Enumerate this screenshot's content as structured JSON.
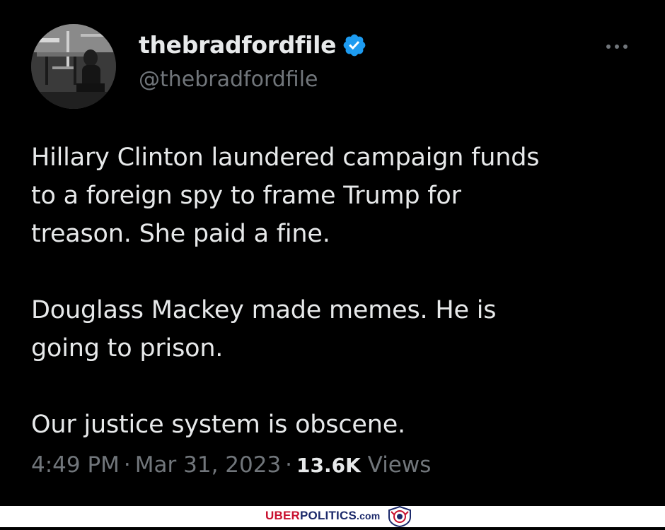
{
  "tweet": {
    "display_name": "thebradfordfile",
    "handle": "@thebradfordfile",
    "verified": true,
    "paragraphs": [
      "Hillary Clinton laundered campaign funds\nto a foreign spy to frame Trump for\ntreason. She paid a fine.",
      "Douglass Mackey made memes. He is\ngoing to prison.",
      "Our justice system is obscene."
    ],
    "time": "4:49 PM",
    "date": "Mar 31, 2023",
    "views_count": "13.6K",
    "views_label": "Views",
    "separator": "·"
  },
  "footer": {
    "brand_prefix": "UBER",
    "brand_main": "POLITICS",
    "brand_suffix": ".com"
  },
  "colors": {
    "background": "#000000",
    "primary_text": "#e7e9ea",
    "secondary_text": "#71767b",
    "verified_badge": "#1d9bf0",
    "brand_red": "#c8102e",
    "brand_blue": "#1c2a6b"
  },
  "icons": {
    "verified": "verified-badge-icon",
    "more": "more-options-icon",
    "brand_logo": "lion-crest-icon"
  }
}
